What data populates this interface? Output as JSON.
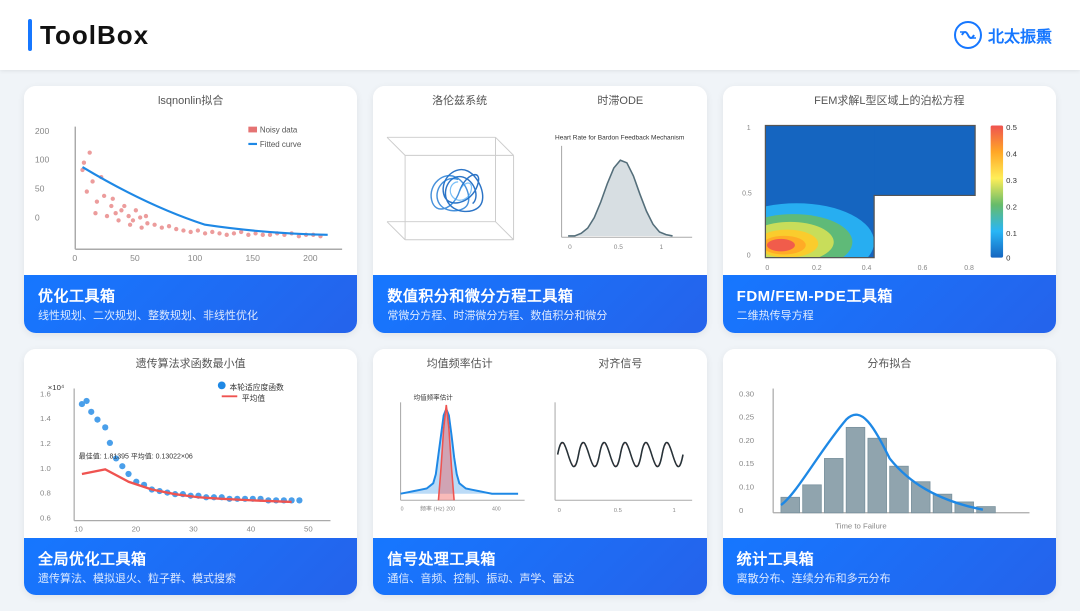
{
  "header": {
    "accent_color": "#1677ff",
    "title": "ToolBox",
    "logo_text": "北太振熏",
    "logo_icon": "⚡"
  },
  "cards": [
    {
      "id": "lsqnonlin",
      "chart_label": "lsqnonlin拟合",
      "footer_title": "优化工具箱",
      "footer_desc": "线性规划、二次规划、整数规划、非线性优化",
      "chart_type": "scatter"
    },
    {
      "id": "lorenz-ode",
      "chart_label_left": "洛伦兹系统",
      "chart_label_right": "时滞ODE",
      "footer_title": "数值积分和微分方程工具箱",
      "footer_desc": "常微分方程、时滞微分方程、数值积分和微分",
      "chart_type": "split"
    },
    {
      "id": "fem-pde",
      "chart_label": "FEM求解L型区域上的泊松方程",
      "footer_title": "FDM/FEM-PDE工具箱",
      "footer_desc": "二维热传导方程",
      "chart_type": "contour"
    },
    {
      "id": "genetic",
      "chart_label": "遗传算法求函数最小值",
      "footer_title": "全局优化工具箱",
      "footer_desc": "遗传算法、模拟退火、粒子群、模式搜索",
      "chart_type": "genetic"
    },
    {
      "id": "signal",
      "chart_label_left": "均值频率估计",
      "chart_label_right": "对齐信号",
      "footer_title": "信号处理工具箱",
      "footer_desc": "通信、音频、控制、振动、声学、雷达",
      "chart_type": "signal"
    },
    {
      "id": "stats",
      "chart_label": "分布拟合",
      "footer_title": "统计工具箱",
      "footer_desc": "离散分布、连续分布和多元分布",
      "chart_type": "histogram"
    }
  ]
}
